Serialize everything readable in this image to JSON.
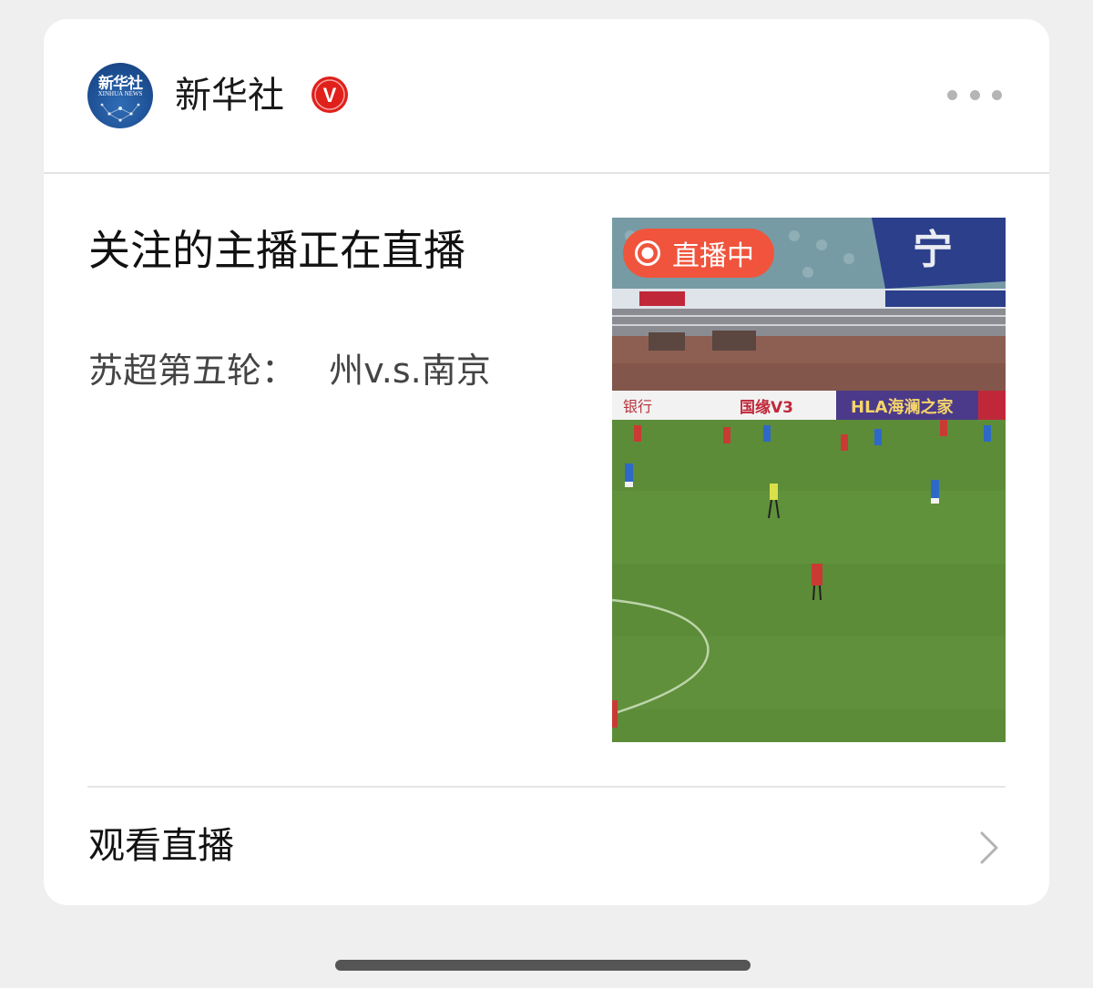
{
  "account": {
    "name": "新华社",
    "logo_text_cn": "新华社",
    "logo_text_en": "XINHUA NEWS",
    "verified_icon": "verified-v-icon",
    "verified_mark": "V"
  },
  "header": {
    "more_icon": "more-dots-icon"
  },
  "post": {
    "title": "关注的主播正在直播",
    "subtitle": "苏超第五轮：   州v.s.南京"
  },
  "video": {
    "live_badge_label": "直播中",
    "ad_boards": [
      "国缘V3",
      "HLA海澜之家"
    ]
  },
  "footer": {
    "watch_label": "观看直播",
    "chevron_icon": "chevron-right-icon"
  },
  "colors": {
    "live_badge": "#f0543c",
    "verified": "#e0201b",
    "pitch": "#5f8f3c"
  }
}
